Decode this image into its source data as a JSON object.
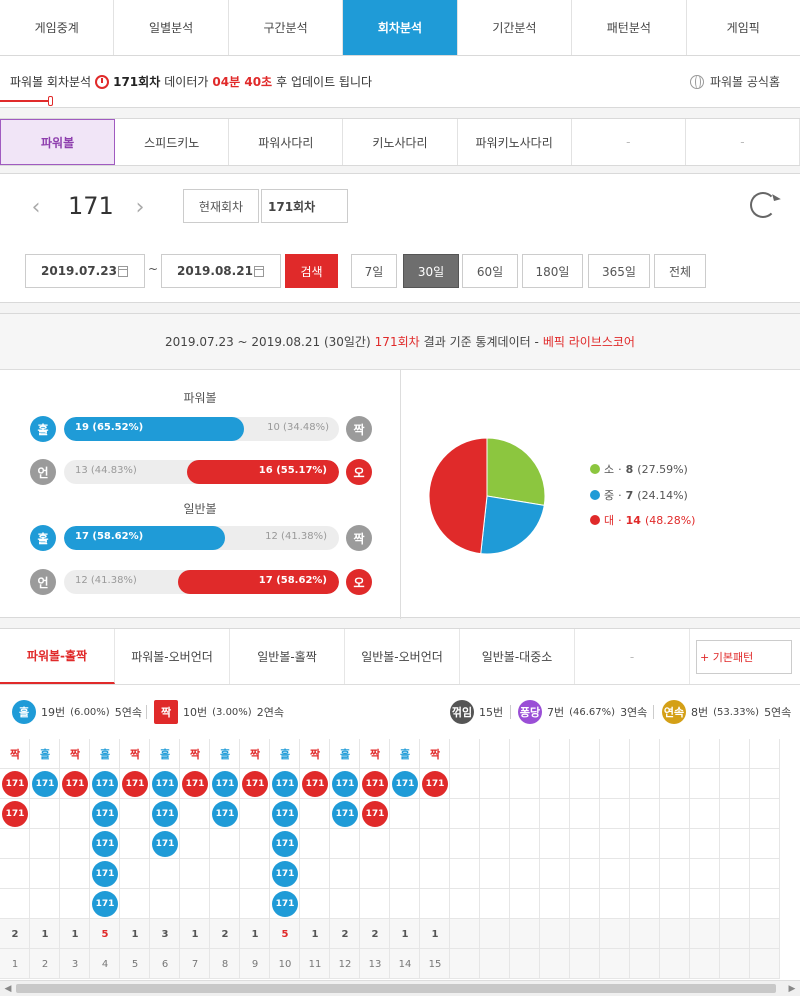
{
  "topnav": {
    "tabs": [
      "게임중계",
      "일별분석",
      "구간분석",
      "회차분석",
      "기간분석",
      "패턴분석",
      "게임픽"
    ],
    "active_index": 3
  },
  "infobar": {
    "prefix": "파워볼 회차분석",
    "round": "171회차",
    "text1": "데이터가",
    "countdown": "04분 40초",
    "text2": "후 업데이트 됩니다",
    "official_link": "파워볼 공식홈"
  },
  "gametabs": {
    "tabs": [
      "파워볼",
      "스피드키노",
      "파워사다리",
      "키노사다리",
      "파워키노사다리",
      "-",
      "-"
    ],
    "active_index": 0
  },
  "control": {
    "prev_icon": "‹",
    "next_icon": "›",
    "round_number": "171",
    "current_btn": "현재회차",
    "round_field": "171회차",
    "date_from": "2019.07.23",
    "date_to": "2019.08.21",
    "tilde": "~",
    "search": "검색",
    "periods": [
      "7일",
      "30일",
      "60일",
      "180일",
      "365일",
      "전체"
    ],
    "active_period": 1
  },
  "stats": {
    "head_range": "2019.07.23 ~ 2019.08.21 (30일간)",
    "head_round": "171회차",
    "head_mid": "결과 기준 통계데이터 -",
    "head_brand": "베픽 라이브스코어",
    "power_title": "파워볼",
    "normal_title": "일반볼",
    "power_odd": {
      "left_ball": "홀",
      "left_label": "19 (65.52%)",
      "left_pct": 65.52,
      "right_label": "10 (34.48%)",
      "right_ball": "짝"
    },
    "power_ou": {
      "left_ball": "언",
      "left_label": "13 (44.83%)",
      "right_pct": 55.17,
      "right_label": "16 (55.17%)",
      "right_ball": "오"
    },
    "normal_odd": {
      "left_ball": "홀",
      "left_label": "17 (58.62%)",
      "left_pct": 58.62,
      "right_label": "12 (41.38%)",
      "right_ball": "짝"
    },
    "normal_ou": {
      "left_ball": "언",
      "left_label": "12 (41.38%)",
      "right_pct": 58.62,
      "right_label": "17 (58.62%)",
      "right_ball": "오"
    },
    "legend": [
      {
        "name": "소",
        "count": "8",
        "pct": "(27.59%)",
        "color": "#8cc63f"
      },
      {
        "name": "중",
        "count": "7",
        "pct": "(24.14%)",
        "color": "#1f9bd7"
      },
      {
        "name": "대",
        "count": "14",
        "pct": "(48.28%)",
        "color": "#e02a2a"
      }
    ],
    "colors": {
      "blue": "#1f9bd7",
      "red": "#e02a2a",
      "green": "#8cc63f",
      "gray": "#9b9b9b"
    }
  },
  "chart_data": {
    "type": "pie",
    "categories": [
      "소",
      "중",
      "대"
    ],
    "values": [
      8,
      7,
      14
    ],
    "percentages": [
      27.59,
      24.14,
      48.28
    ],
    "colors": [
      "#8cc63f",
      "#1f9bd7",
      "#e02a2a"
    ],
    "legend_position": "right"
  },
  "pattern": {
    "tabs": [
      "파워볼-홀짝",
      "파워볼-오버언더",
      "일반볼-홀짝",
      "일반볼-오버언더",
      "일반볼-대중소",
      "-"
    ],
    "active_index": 0,
    "basic_btn": "+ 기본패턴",
    "summary": {
      "odd": {
        "icon": "홀",
        "count": "19번",
        "pct": "(6.00%)",
        "streak": "5연속"
      },
      "even": {
        "icon": "짝",
        "count": "10번",
        "pct": "(3.00%)",
        "streak": "2연속"
      },
      "break": {
        "icon": "꺾임",
        "count": "15번"
      },
      "pong": {
        "icon": "퐁당",
        "count": "7번",
        "pct": "(46.67%)",
        "streak": "3연속"
      },
      "cont": {
        "icon": "연속",
        "count": "8번",
        "pct": "(53.33%)",
        "streak": "5연속"
      }
    },
    "headers": [
      "짝",
      "홀",
      "짝",
      "홀",
      "짝",
      "홀",
      "짝",
      "홀",
      "짝",
      "홀",
      "짝",
      "홀",
      "짝",
      "홀",
      "짝"
    ],
    "chip_label": "171",
    "counts": [
      "2",
      "1",
      "1",
      "5",
      "1",
      "3",
      "1",
      "2",
      "1",
      "5",
      "1",
      "2",
      "2",
      "1",
      "1"
    ],
    "indices": [
      "1",
      "2",
      "3",
      "4",
      "5",
      "6",
      "7",
      "8",
      "9",
      "10",
      "11",
      "12",
      "13",
      "14",
      "15"
    ]
  }
}
